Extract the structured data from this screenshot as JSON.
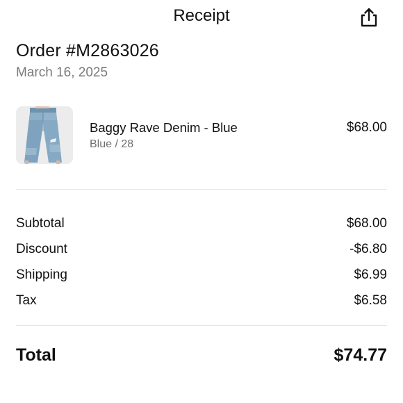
{
  "header": {
    "title": "Receipt",
    "share_icon": "share-icon"
  },
  "order": {
    "number": "Order #M2863026",
    "date": "March 16, 2025"
  },
  "item": {
    "name": "Baggy Rave Denim - Blue",
    "variant": "Blue / 28",
    "price": "$68.00"
  },
  "summary": [
    {
      "label": "Subtotal",
      "value": "$68.00"
    },
    {
      "label": "Discount",
      "value": "-$6.80"
    },
    {
      "label": "Shipping",
      "value": "$6.99"
    },
    {
      "label": "Tax",
      "value": "$6.58"
    }
  ],
  "total": {
    "label": "Total",
    "value": "$74.77"
  }
}
